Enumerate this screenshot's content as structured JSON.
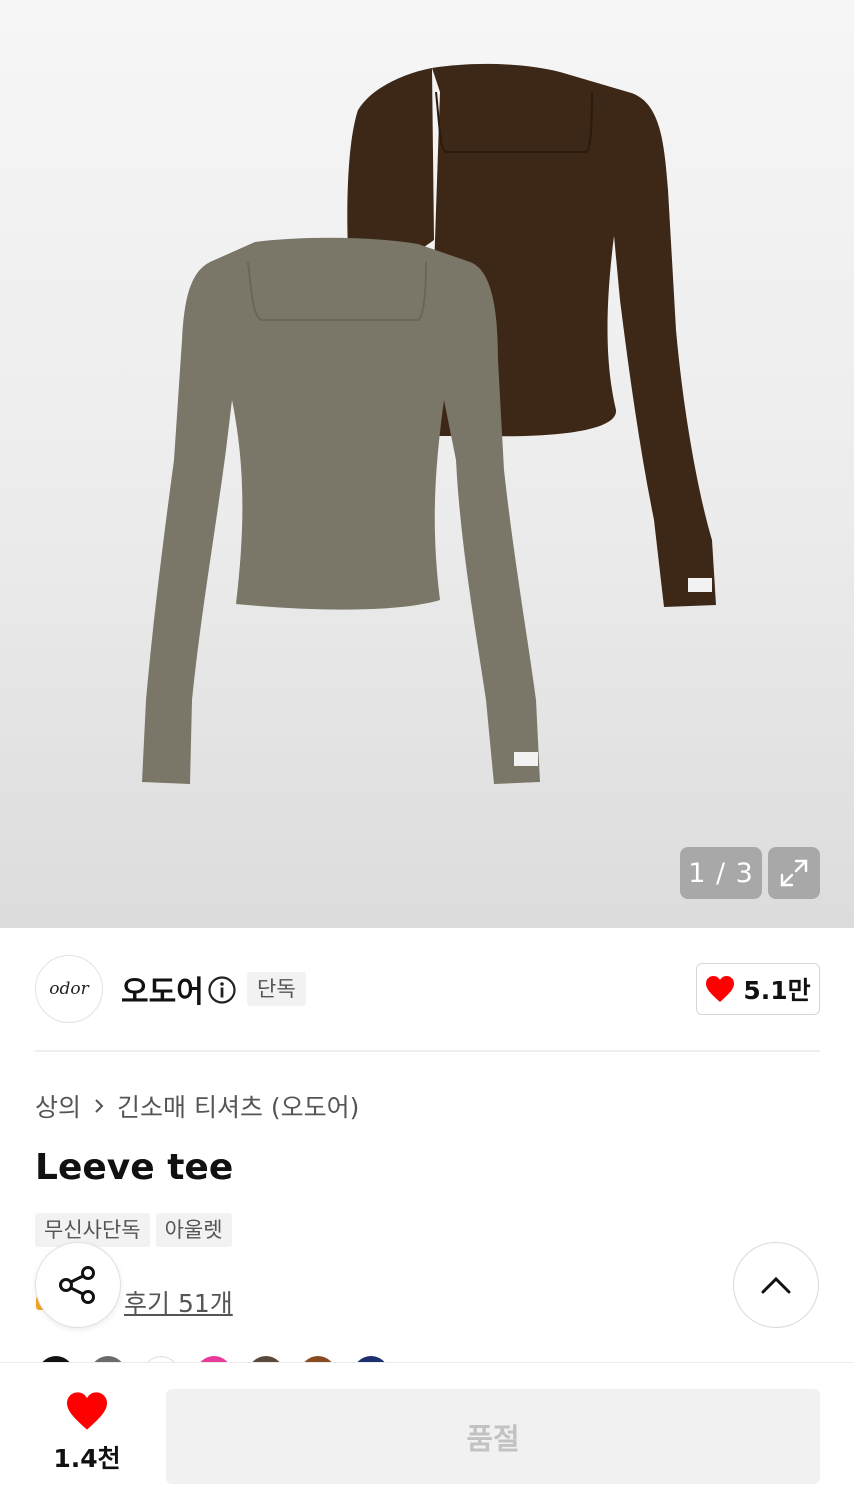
{
  "gallery": {
    "pager_text": "1 / 3",
    "image_alt": "Leeve tee product photo: khaki and brown long-sleeve tees",
    "colors": {
      "khaki": "#7a7668",
      "brown": "#3d2817"
    }
  },
  "brand": {
    "logo_text": "odor",
    "name": "오도어",
    "badge": "단독",
    "likes": "5.1만"
  },
  "breadcrumb": {
    "items": [
      "상의",
      "긴소매 티셔츠 (오도어)"
    ],
    "separator_icon": "chevron-right-icon"
  },
  "product": {
    "title": "Leeve tee",
    "tags": [
      "무신사단독",
      "아울렛"
    ],
    "review_link": "후기 51개"
  },
  "color_swatches": [
    "#111111",
    "#6b6b6b",
    "#ffffff",
    "#e83a9a",
    "#5a4a3e",
    "#8a4a1f",
    "#1c2f6e"
  ],
  "bottom_bar": {
    "wish_count": "1.4천",
    "soldout_label": "품절",
    "heart_color": "#ff0000"
  }
}
